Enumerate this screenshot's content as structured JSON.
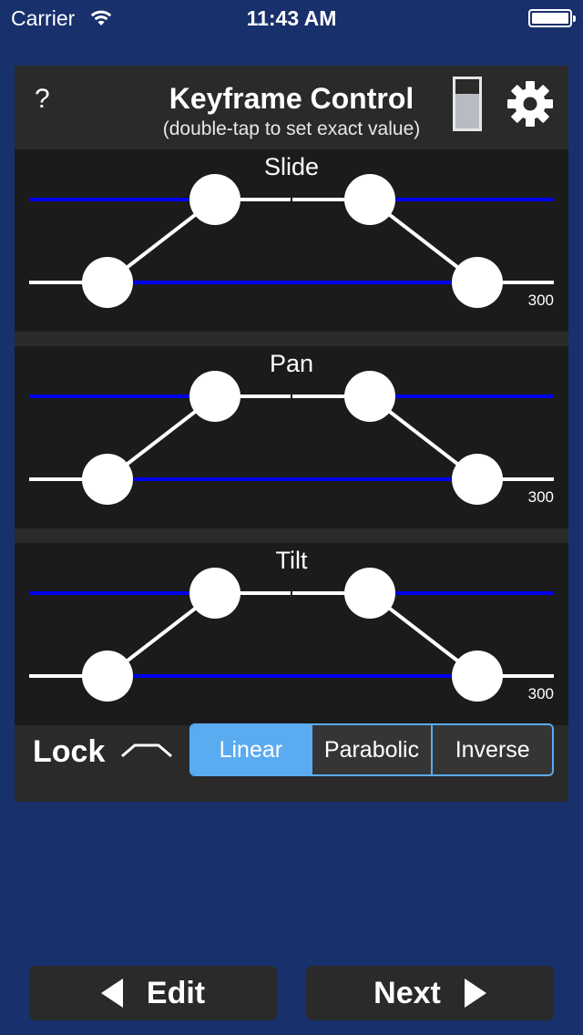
{
  "status_bar": {
    "carrier": "Carrier",
    "time": "11:43 AM"
  },
  "header": {
    "help_label": "?",
    "title": "Keyframe Control",
    "subtitle": "(double-tap to set exact value)",
    "level_fraction": 0.7
  },
  "curves": [
    {
      "name": "Slide",
      "max_value": "300"
    },
    {
      "name": "Pan",
      "max_value": "300"
    },
    {
      "name": "Tilt",
      "max_value": "300"
    }
  ],
  "footer": {
    "lock_label": "Lock",
    "interpolation_options": [
      "Linear",
      "Parabolic",
      "Inverse"
    ],
    "selected_interpolation": "Linear"
  },
  "nav": {
    "edit_label": "Edit",
    "next_label": "Next"
  },
  "colors": {
    "background": "#18306c",
    "panel": "#2a2a2a",
    "curve_bg": "#1b1b1b",
    "track_line": "#0000ee",
    "accent": "#5aabf0"
  },
  "icons": {
    "help": "help-icon",
    "level": "level-icon",
    "settings": "gear-icon",
    "lock": "lock-curve-icon",
    "back": "left-triangle-icon",
    "forward": "right-triangle-icon"
  }
}
